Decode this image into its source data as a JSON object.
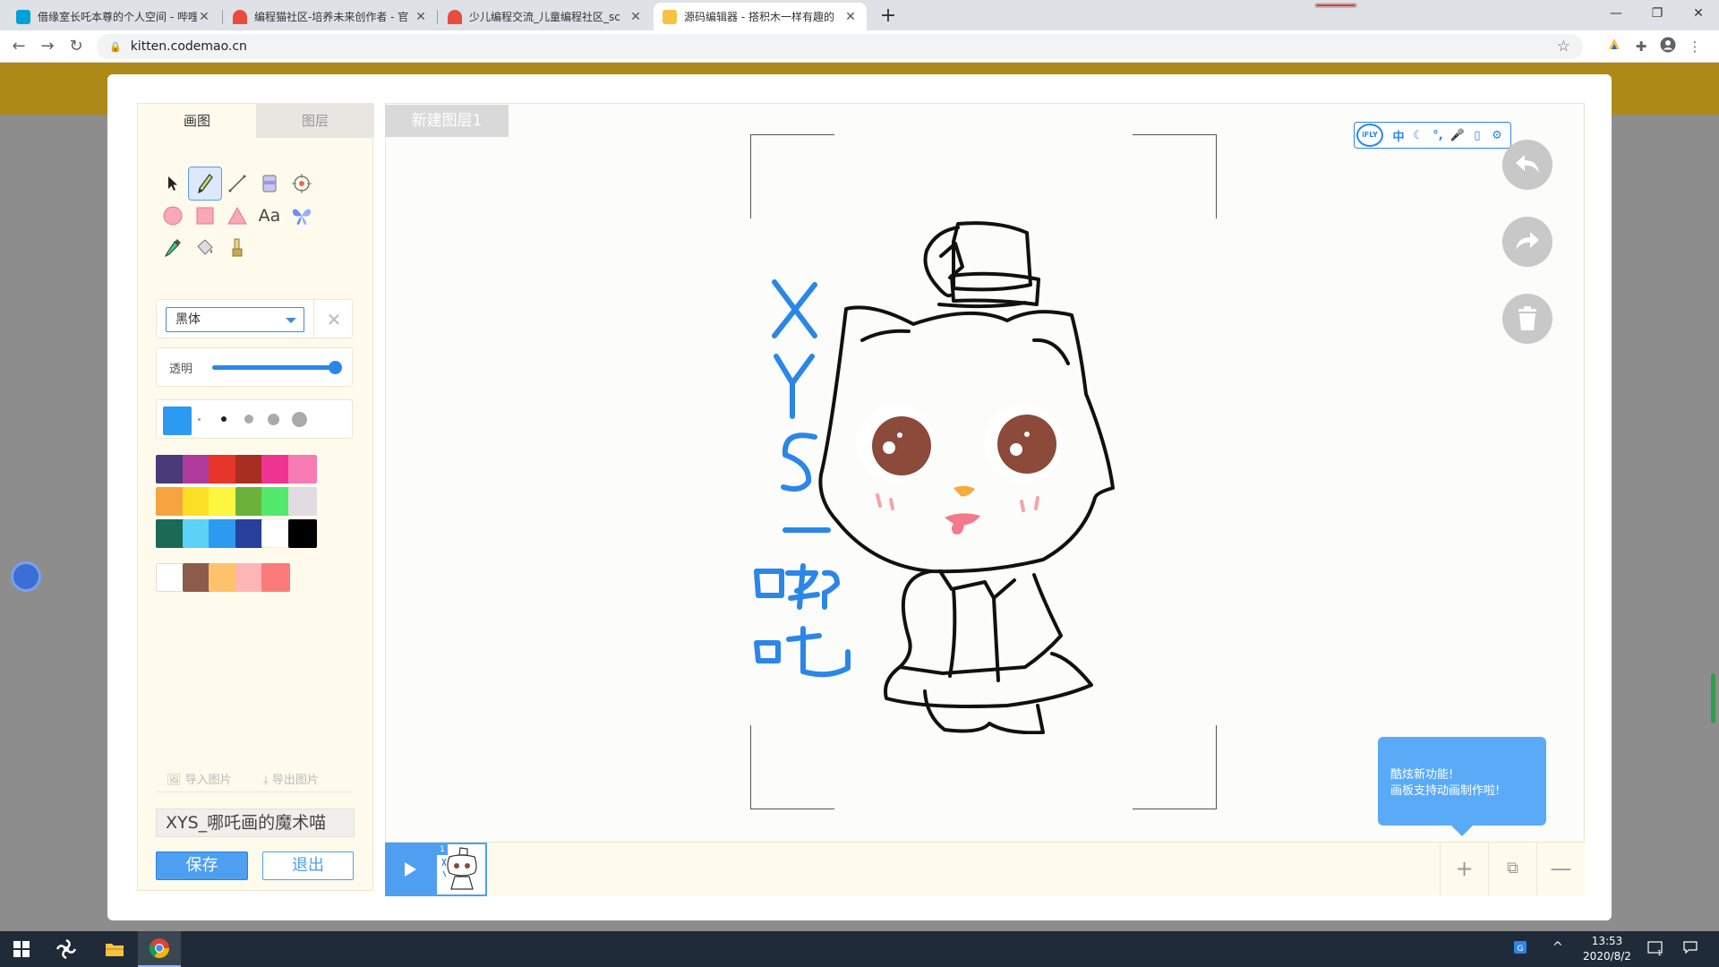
{
  "browser": {
    "tabs": [
      {
        "title": "借缘室长吒本尊的个人空间 - 哔哩",
        "favicon_color": "#00a1d6"
      },
      {
        "title": "编程猫社区-培养未来创作者 - 官",
        "favicon_color": "#e84c3d"
      },
      {
        "title": "少儿编程交流_儿童编程社区_sc",
        "favicon_color": "#e84c3d"
      },
      {
        "title": "源码编辑器 - 搭积木一样有趣的",
        "favicon_color": "#f6c343"
      }
    ],
    "new_tab": "+",
    "url": "kitten.codemao.cn",
    "window_minimize": "—",
    "window_restore": "❐",
    "window_close": "✕"
  },
  "editor": {
    "tabs": {
      "draw": "画图",
      "layers": "图层"
    },
    "font": {
      "selected": "黑体"
    },
    "opacity_label": "透明",
    "opacity_value": 100,
    "current_color": "#2b9af0",
    "palette": [
      "#4b3a7a",
      "#b0399c",
      "#e8352a",
      "#a82e21",
      "#ef3491",
      "#f77cb5",
      "#f6a440",
      "#fbdf24",
      "#fcf640",
      "#6bb23a",
      "#53e86e",
      "#e1dbe2",
      "#1a6a56",
      "#5cd2f6",
      "#2b9af0",
      "#283f9c",
      "#ffffff",
      "#000000"
    ],
    "extra_colors": [
      "#ffffff",
      "#8c5b4a",
      "#fec36a",
      "#fdb5b6",
      "#fb7b7a"
    ],
    "import_image": "导入图片",
    "export_image": "导出图片",
    "work_name": "XYS_哪吒画的魔术喵",
    "save_label": "保存",
    "exit_label": "退出",
    "layer_name": "新建图层1",
    "voice_bar": {
      "logo": "iFLY",
      "chinese": "中"
    },
    "tip_lines": [
      "酷炫新功能!",
      "画板支持动画制作啦!"
    ],
    "timeline": {
      "frame_number": "1"
    }
  },
  "taskbar": {
    "time": "13:53",
    "date": "2020/8/2",
    "notification_count": "1"
  }
}
